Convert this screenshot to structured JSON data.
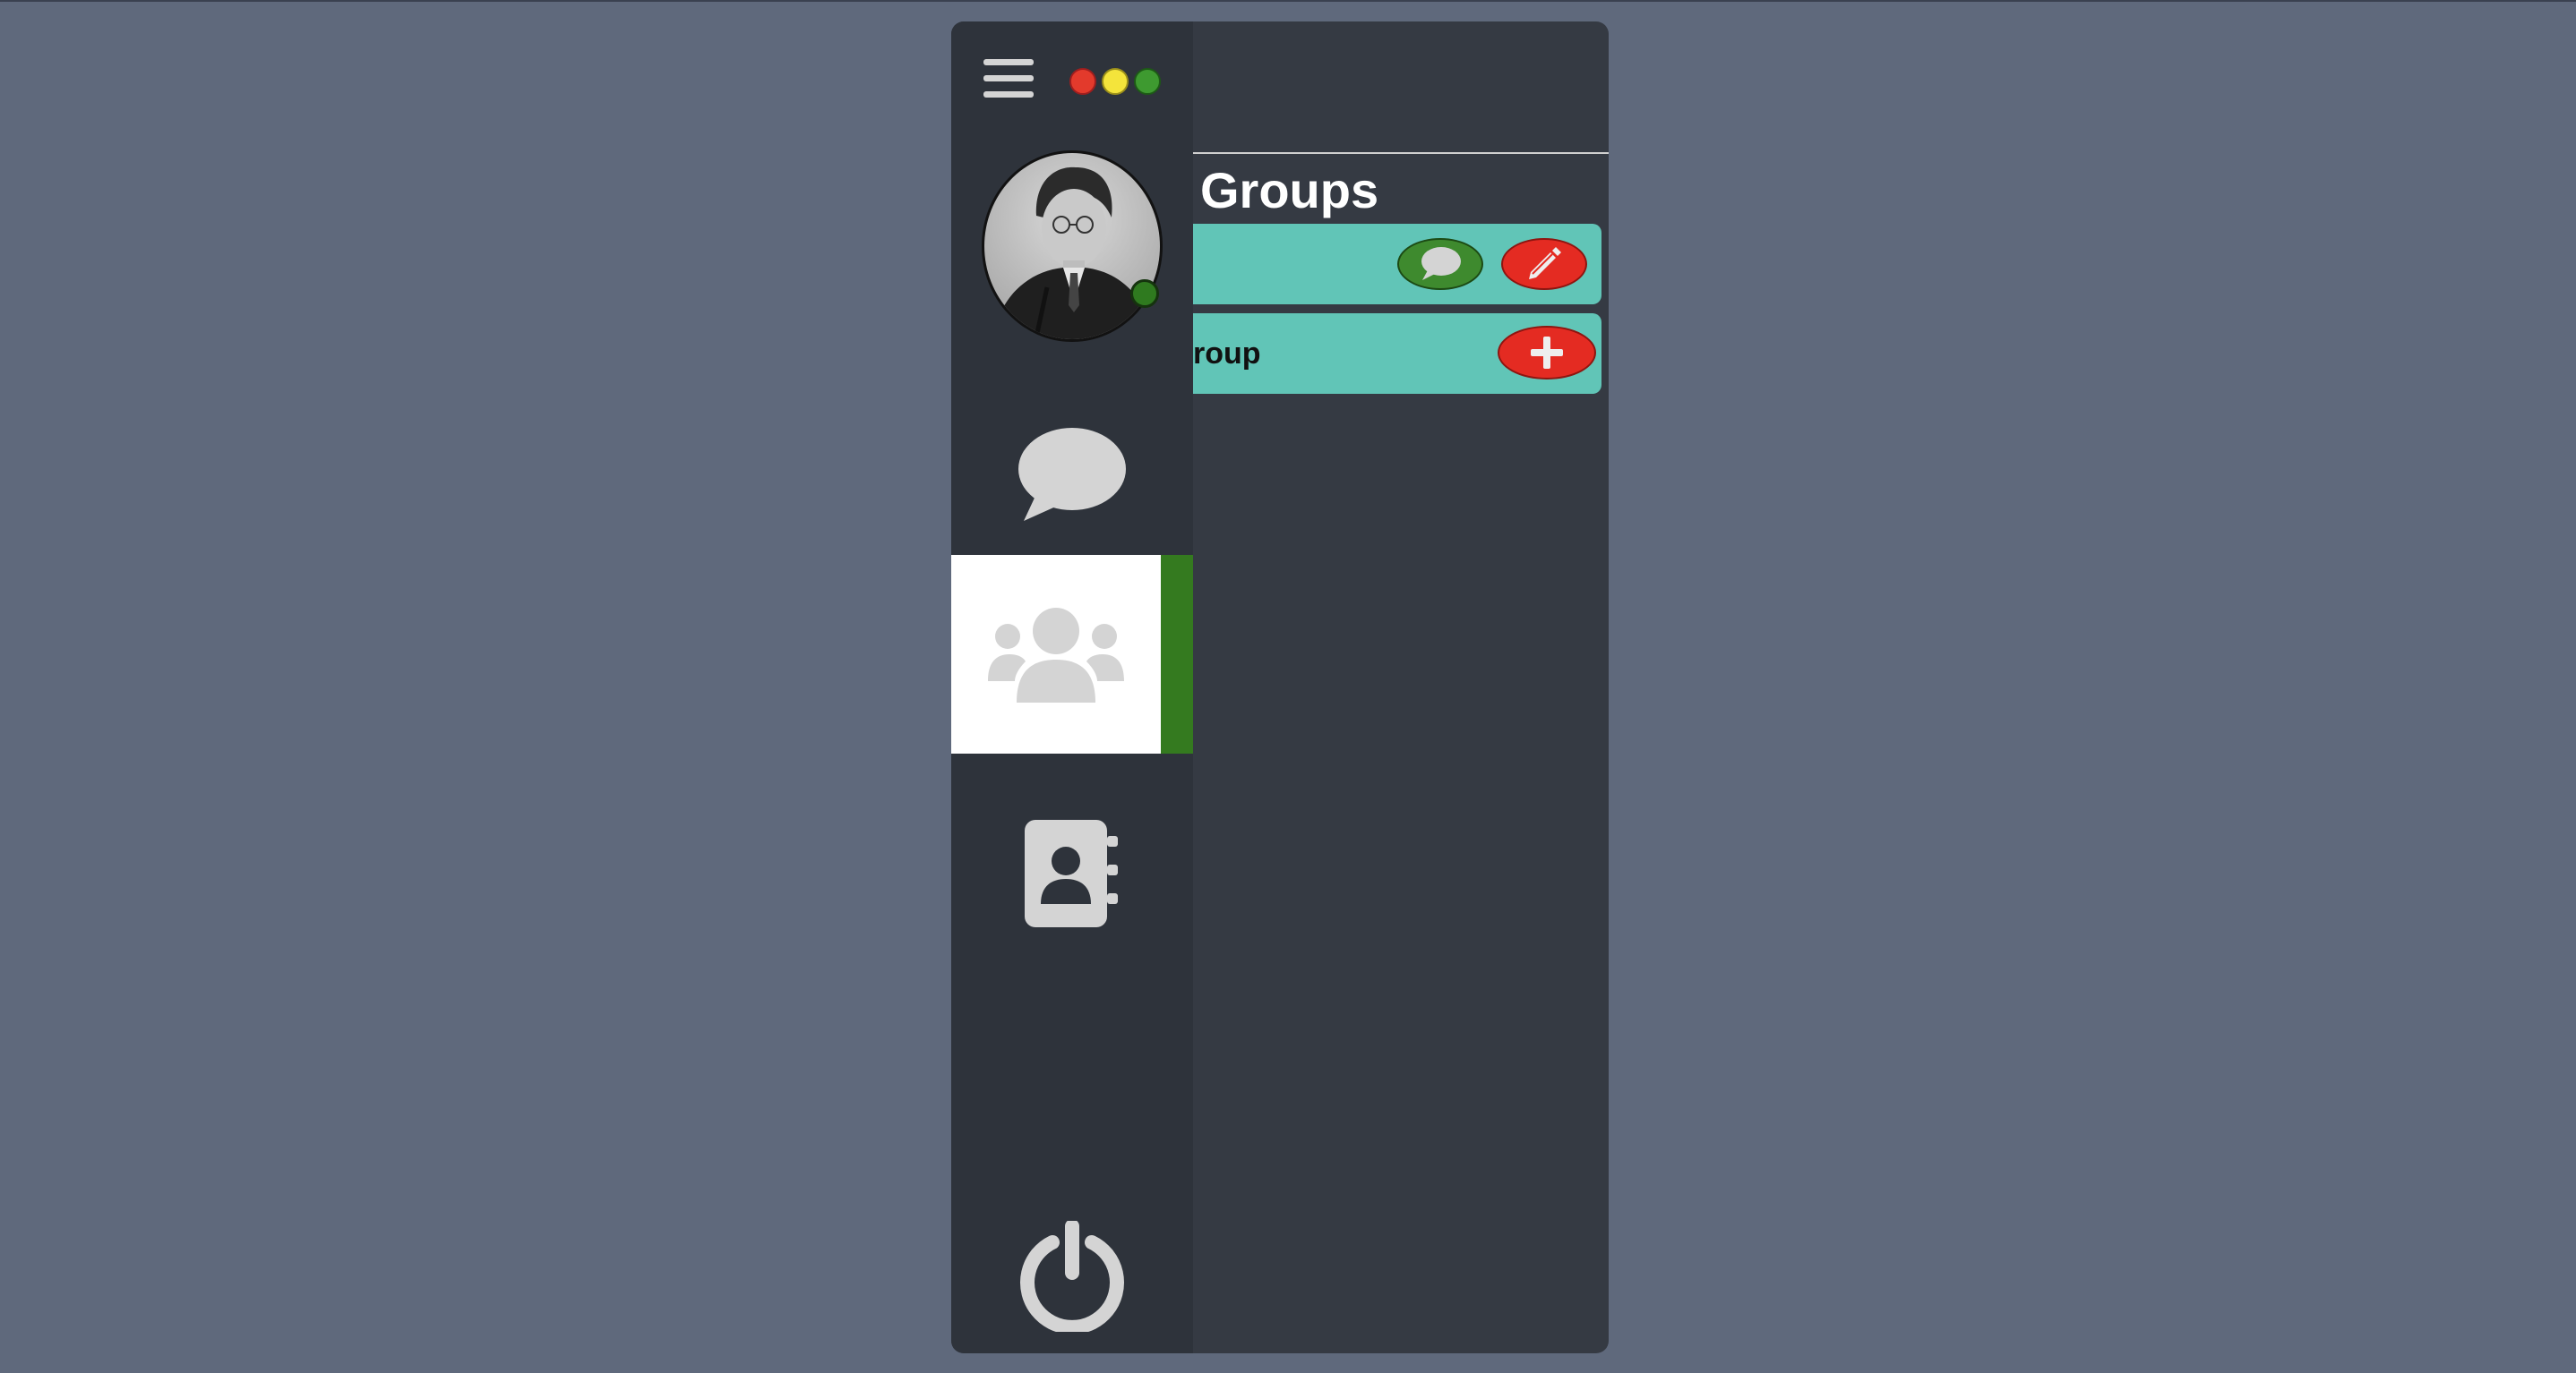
{
  "colors": {
    "page_bg": "#5f697c",
    "window_bg": "#353a43",
    "sidebar_bg": "#2e333b",
    "active_nav_bg": "#ffffff",
    "active_indicator": "#347a1f",
    "row_bg": "#61c5b7",
    "online_status": "#2f7a1f",
    "action_green": "#3e8a2e",
    "action_red": "#e42b22"
  },
  "window_controls": [
    "close",
    "minimize",
    "maximize"
  ],
  "sidebar": {
    "menu_icon": "hamburger-menu-icon",
    "avatar_status": "online",
    "items": [
      {
        "name": "chats",
        "icon": "chat-bubble-icon",
        "active": false
      },
      {
        "name": "groups",
        "icon": "users-group-icon",
        "active": true
      },
      {
        "name": "contacts",
        "icon": "address-book-icon",
        "active": false
      }
    ],
    "logout_icon": "power-icon"
  },
  "panel": {
    "title": "Groups",
    "rows": [
      {
        "label": "",
        "actions": [
          "chat-bubble-icon",
          "pencil-icon"
        ]
      },
      {
        "label": "roup",
        "actions": [
          "plus-icon"
        ]
      }
    ]
  }
}
